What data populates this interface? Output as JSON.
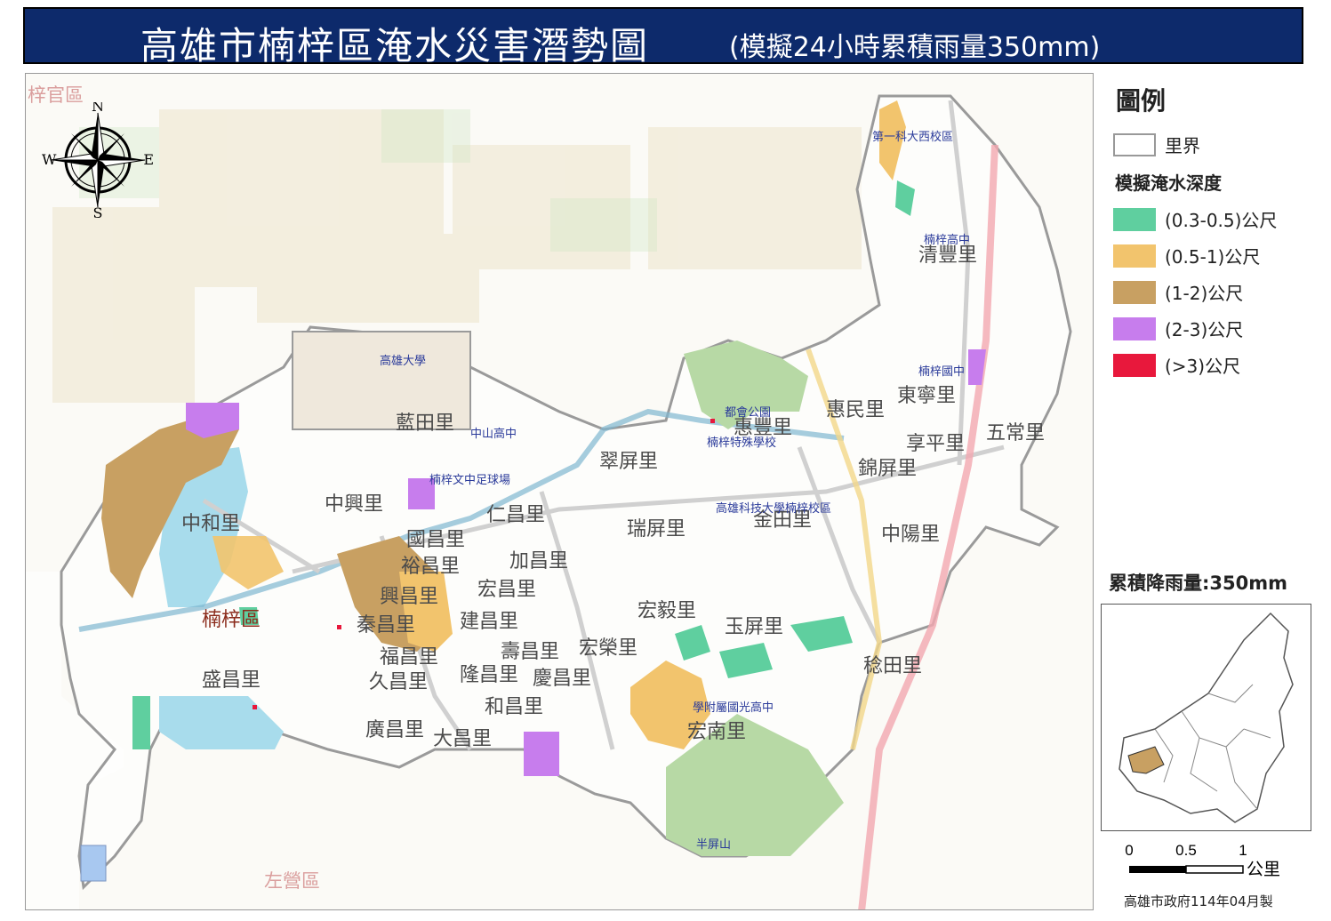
{
  "banner": {
    "title": "高雄市楠梓區淹水災害潛勢圖",
    "subtitle": "(模擬24小時累積雨量350mm)"
  },
  "compass": {
    "n": "N",
    "s": "S",
    "e": "E",
    "w": "W"
  },
  "legend": {
    "title": "圖例",
    "boundary_label": "里界",
    "depth_title": "模擬淹水深度",
    "items": [
      {
        "label": "(0.3-0.5)公尺",
        "color": "#5fcf9f"
      },
      {
        "label": "(0.5-1)公尺",
        "color": "#f2c46d"
      },
      {
        "label": "(1-2)公尺",
        "color": "#c8a062"
      },
      {
        "label": "(2-3)公尺",
        "color": "#c77ded"
      },
      {
        "label": "(>3)公尺",
        "color": "#e8183c"
      }
    ]
  },
  "rainfall": "累積降雨量:350mm",
  "scale": {
    "t0": "0",
    "t1": "0.5",
    "t2": "1",
    "unit": "公里"
  },
  "credit": "高雄市政府114年04月製",
  "map": {
    "district": "楠梓區",
    "neighbors": [
      "梓官區",
      "左營區"
    ],
    "villages": [
      "藍田里",
      "中興里",
      "中和里",
      "仁昌里",
      "瑞屏里",
      "惠豐里",
      "惠民里",
      "東寧里",
      "五常里",
      "享平里",
      "錦屏里",
      "清豐里",
      "中陽里",
      "金田里",
      "翠屏里",
      "加昌里",
      "宏昌里",
      "建昌里",
      "興昌里",
      "秦昌里",
      "裕昌里",
      "福昌里",
      "久昌里",
      "盛昌里",
      "廣昌里",
      "大昌里",
      "和昌里",
      "隆昌里",
      "慶昌里",
      "壽昌里",
      "宏榮里",
      "宏毅里",
      "玉屏里",
      "宏南里",
      "稔田里",
      "國昌里"
    ],
    "pois": [
      "高雄大學",
      "中山高中",
      "楠梓高中",
      "楠梓國中",
      "高雄科技大學楠梓校區",
      "楠梓文中足球場",
      "都會公園",
      "半屏山",
      "楠梓特殊學校",
      "學附屬國光高中",
      "第一科大西校區"
    ]
  }
}
